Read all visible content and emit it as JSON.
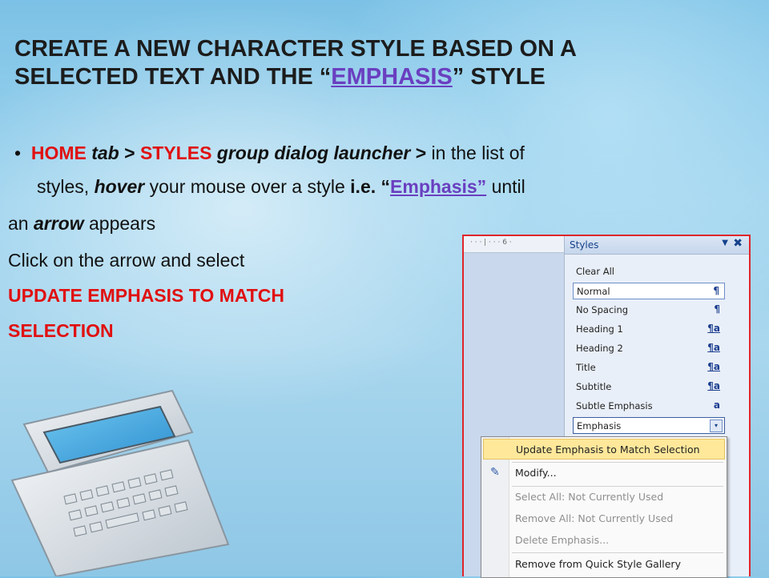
{
  "title": {
    "line1": "CREATE A NEW CHARACTER STYLE BASED ON A",
    "line2_pre": "SELECTED TEXT AND THE “",
    "line2_link": "EMPHASIS",
    "line2_post": "” STYLE"
  },
  "bullet": {
    "marker": "•",
    "l1_home": "HOME",
    "l1_tab": " tab",
    "l1_gt1": " > ",
    "l1_styles": "STYLES",
    "l1_group": " group dialog launcher",
    "l1_gt2": " >",
    "l1_rest": " in the list of",
    "l2_a": "styles, ",
    "l2_hover": "hover",
    "l2_b": " your mouse over a style ",
    "l2_ie": "i.e. “",
    "l2_link": "Emphasis”",
    "l2_c": " until"
  },
  "body": {
    "l3_a": "an ",
    "l3_arrow": "arrow",
    "l3_b": " appears",
    "l4": "Click on the arrow and select",
    "l5": "UPDATE EMPHASIS TO MATCH",
    "l6": "SELECTION"
  },
  "screenshot": {
    "ruler_marks": "· · · | · · · 6 ·",
    "pane_title": "Styles",
    "dropdown_icon": "▼",
    "close_icon": "✖",
    "styles": [
      {
        "label": "Clear All",
        "symbol": ""
      },
      {
        "label": "Normal",
        "symbol": "¶"
      },
      {
        "label": "No Spacing",
        "symbol": "¶"
      },
      {
        "label": "Heading 1",
        "symbol": "¶a"
      },
      {
        "label": "Heading 2",
        "symbol": "¶a"
      },
      {
        "label": "Title",
        "symbol": "¶a"
      },
      {
        "label": "Subtitle",
        "symbol": "¶a"
      },
      {
        "label": "Subtle Emphasis",
        "symbol": "a"
      },
      {
        "label": "Emphasis",
        "symbol": "▾"
      }
    ],
    "menu": [
      {
        "label": "Update Emphasis to Match Selection",
        "state": "highlight"
      },
      {
        "label": "Modify...",
        "state": "normal"
      },
      {
        "label": "Select All: Not Currently Used",
        "state": "disabled"
      },
      {
        "label": "Remove All: Not Currently Used",
        "state": "disabled"
      },
      {
        "label": "Delete Emphasis...",
        "state": "disabled"
      },
      {
        "label": "Remove from Quick Style Gallery",
        "state": "normal"
      }
    ],
    "modify_icon": "✎"
  },
  "colors": {
    "accent_red": "#e01010",
    "link_purple": "#6a3fc0",
    "menu_highlight": "#ffe89a",
    "panel_border": "#e0252a"
  }
}
